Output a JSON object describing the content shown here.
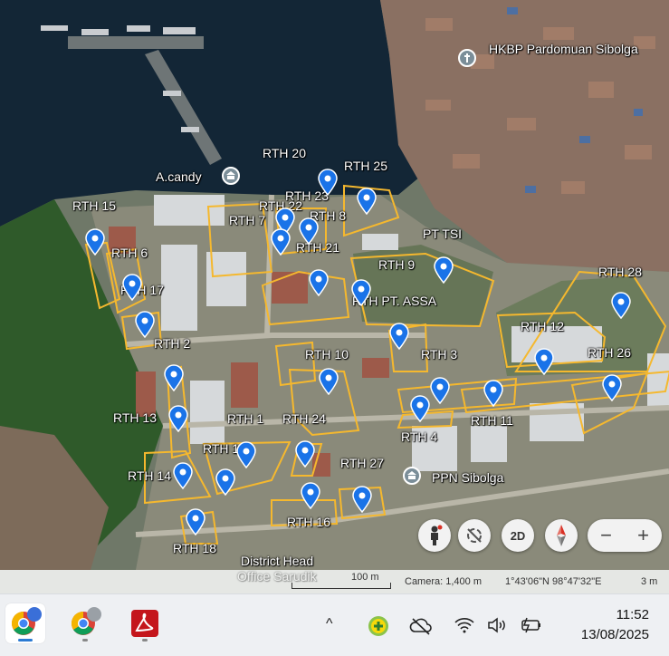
{
  "map": {
    "places": {
      "church": "HKBP Pardomuan Sibolga",
      "museum": "A.candy",
      "company_tsi": "PT TSI",
      "company_assa": "PT. ASSA",
      "port": "PPN Sibolga",
      "district_head": "District Head",
      "district_head_faded": "Office Sarudik"
    },
    "areas": {
      "rth1": "RTH 1",
      "rth2": "RTH 2",
      "rth3": "RTH 3",
      "rth4": "RTH 4",
      "rth6": "RTH 6",
      "rth7": "RTH 7",
      "rth8": "RTH 8",
      "rth9": "RTH 9",
      "rth10": "RTH 10",
      "rth11": "RTH 11",
      "rth12": "RTH 12",
      "rth13": "RTH 13",
      "rth14": "RTH 14",
      "rth15": "RTH 15",
      "rth16": "RTH 16",
      "rth17": "RTH 17",
      "rth18": "RTH 18",
      "rth19": "RTH 19",
      "rth20": "RTH 20",
      "rth21": "RTH 21",
      "rth22": "RTH 22",
      "rth23": "RTH 23",
      "rth24": "RTH 24",
      "rth25": "RTH 25",
      "rth26": "RTH 26",
      "rth27": "RTH 27",
      "rth28": "RTH 28",
      "rth_prefix": "RTH"
    },
    "colors": {
      "boundary": "#f5b82e",
      "pin": "#1a73e8",
      "water": "#142a3a"
    }
  },
  "controls": {
    "view_mode": "2D",
    "zoom_out": "−",
    "zoom_in": "+"
  },
  "status": {
    "scale": "100 m",
    "camera": "Camera: 1,400 m",
    "coords": "1°43'06\"N 98°47'32\"E",
    "elevation": "3 m"
  },
  "taskbar": {
    "apps": [
      "chrome-profile-1",
      "chrome-profile-2",
      "acrobat-reader"
    ],
    "tray": {
      "chevron": "^"
    },
    "time": "11:52",
    "date": "13/08/2025"
  }
}
